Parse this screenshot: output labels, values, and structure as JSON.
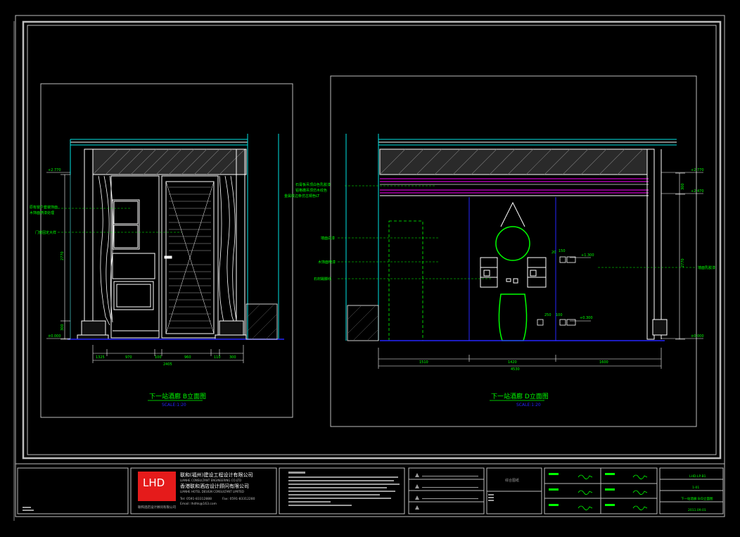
{
  "left_view": {
    "title": "下一站酒廊  B立面图",
    "scale": "SCALE:1:20",
    "dims_bottom": [
      "1325",
      "970",
      "100",
      "960",
      "110",
      "300"
    ],
    "dim_total": "2405",
    "dim_left_height": "2770",
    "dim_left_small": "300",
    "level_top": "+2.770",
    "level_bottom": "±0.000",
    "labels": [
      "原有窗户套装饰面",
      "木饰面喷漆处理",
      "门窗固定大样"
    ]
  },
  "right_view": {
    "title": "下一站酒廊  D立面图",
    "scale": "SCALE:1:20",
    "dims_bottom": [
      "1510",
      "1420",
      "1600"
    ],
    "dim_total": "4530",
    "dim_right_height": "2770",
    "dim_right_small": "300",
    "level_top": "+2.770",
    "level_mid": "+2.470",
    "level_bottom": "±0.000",
    "level_right_a": "+1.300",
    "level_right_b": "+0.300",
    "small_dims": [
      "20",
      "150",
      "250",
      "100"
    ],
    "labels_top": [
      "石膏板吊顶白色乳胶漆",
      "铝格栅吊顶仿木纹色",
      "金属收边条仿古铜色LT"
    ],
    "labels_left": [
      "墙面白漆",
      "木饰面喷漆",
      "石材踢脚线"
    ],
    "label_right": "墙面乳胶漆"
  },
  "title_block": {
    "logo": "LHD",
    "company_cn": "联和(福州)建设工程设计有限公司",
    "company_en": "LIANHE CONSULTANT ENGINEERING CO.LTD",
    "company_hk": "香港联和酒店设计顾问有限公司",
    "company_hk_en": "LIANHE HOTEL DESIGN CONSULTANT LIMITED",
    "contact_tel": "Tel: 0591-83312888",
    "contact_fax": "Fax: 0591-83312280",
    "contact_email": "Email: lhdhk@163.com",
    "logo_caption": "联和酒店设计顾问有限公司",
    "stamp_label": "综合图纸",
    "sheet_no": "LHD-LP-B1",
    "sheet_rev": "1-01",
    "sheet_title": "下一站酒廊  B/D立面图",
    "sheet_date": "2011.09.01"
  },
  "colors": {
    "frame": "#bdbdbd",
    "cad_white": "#ffffff",
    "cyan": "#00e5e5",
    "green": "#00ff00",
    "magenta": "#ff00ff",
    "blue": "#2626ff",
    "red_logo": "#e51b1b"
  }
}
